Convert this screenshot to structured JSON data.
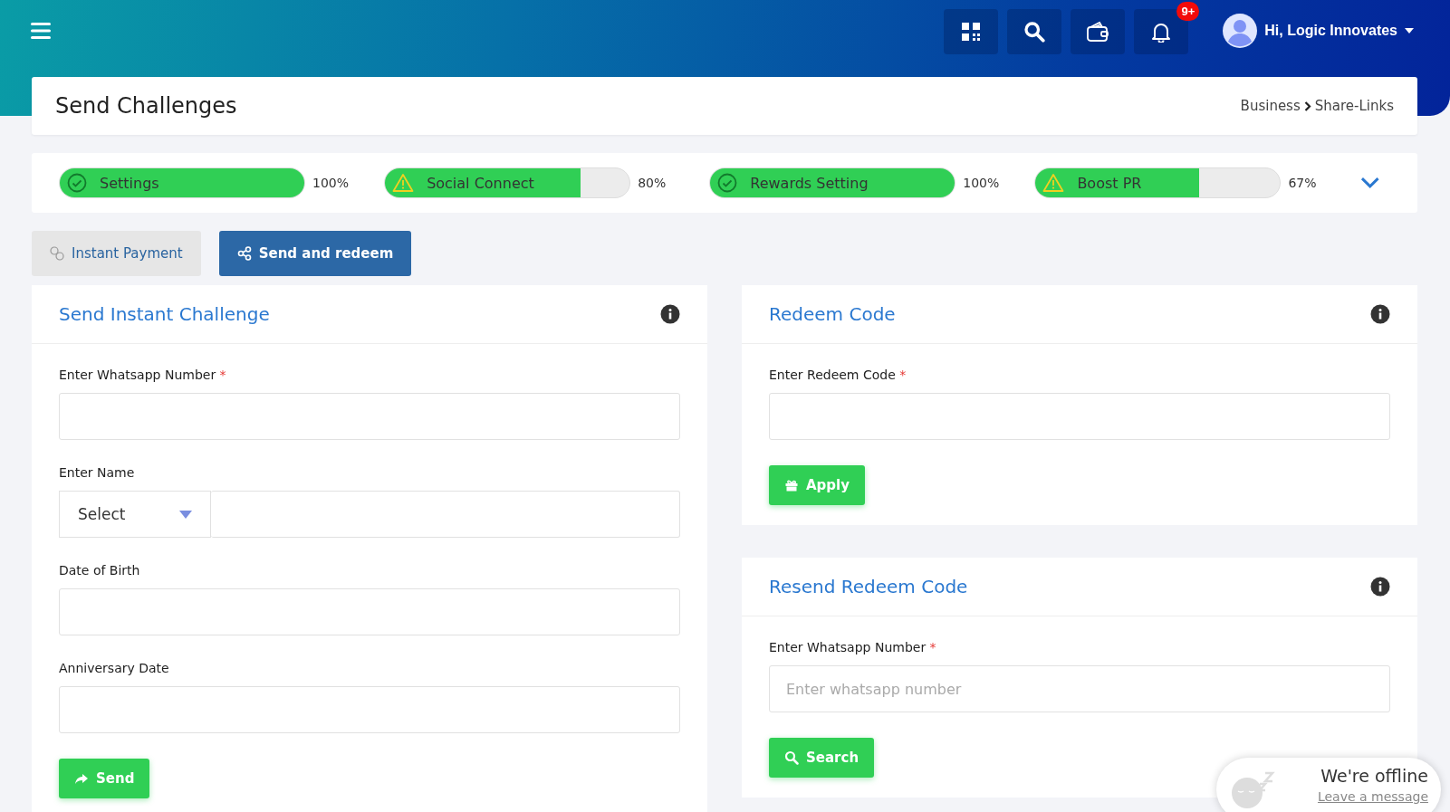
{
  "header": {
    "user_name": "Hi, Logic Innovates",
    "notification_count": "9+"
  },
  "page": {
    "title": "Send Challenges",
    "breadcrumb": [
      "Business",
      "Share-Links"
    ]
  },
  "progress": [
    {
      "label": "Settings",
      "kind": "complete",
      "level": 1,
      "reading": "100%"
    },
    {
      "label": "Social Connect",
      "kind": "warning",
      "level": 0.8,
      "reading": "80%"
    },
    {
      "label": "Rewards Setting",
      "kind": "complete",
      "level": 1,
      "reading": "100%"
    },
    {
      "label": "Boost PR",
      "kind": "warning",
      "level": 0.67,
      "reading": "67%"
    }
  ],
  "tabs": [
    {
      "label": "Instant Payment",
      "selected": false
    },
    {
      "label": "Send and redeem",
      "selected": true
    }
  ],
  "send_card": {
    "title": "Send Instant Challenge",
    "fields": [
      {
        "kind": "text",
        "label": "Enter Whatsapp Number",
        "required_mark": "*"
      },
      {
        "kind": "select-text",
        "label": "Enter Name",
        "select_value": "Select"
      },
      {
        "kind": "text",
        "label": "Date of Birth"
      },
      {
        "kind": "text",
        "label": "Anniversary Date"
      }
    ],
    "button": {
      "label": "Send"
    }
  },
  "redeem_card": {
    "title": "Redeem Code",
    "fields": [
      {
        "kind": "text",
        "label": "Enter Redeem Code",
        "required_mark": "*"
      }
    ],
    "button": {
      "label": "Apply"
    }
  },
  "resend_card": {
    "title": "Resend Redeem Code",
    "fields": [
      {
        "kind": "text",
        "label": "Enter Whatsapp Number",
        "required_mark": "*",
        "placeholder": "Enter whatsapp number"
      }
    ],
    "button": {
      "label": "Search"
    }
  },
  "chat_widget": {
    "status": "We're offline",
    "link": "Leave a message"
  }
}
